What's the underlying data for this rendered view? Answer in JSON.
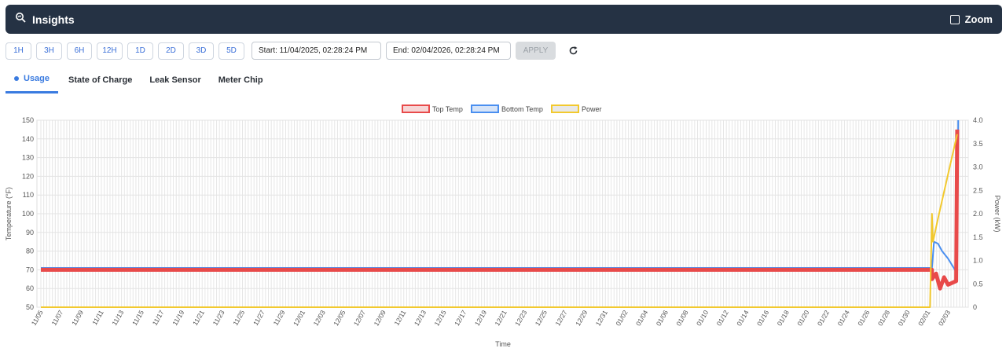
{
  "header": {
    "title": "Insights",
    "zoom_label": "Zoom"
  },
  "toolbar": {
    "ranges": [
      "1H",
      "3H",
      "6H",
      "12H",
      "1D",
      "2D",
      "3D",
      "5D"
    ],
    "start": "Start: 11/04/2025, 02:28:24 PM",
    "end": "End: 02/04/2026, 02:28:24 PM",
    "apply": "APPLY"
  },
  "tabs": [
    {
      "label": "Usage",
      "active": true
    },
    {
      "label": "State of Charge",
      "active": false
    },
    {
      "label": "Leak Sensor",
      "active": false
    },
    {
      "label": "Meter Chip",
      "active": false
    }
  ],
  "colors": {
    "top": "#e84a4a",
    "bottom": "#4a8ff0",
    "power": "#f2c92e",
    "header": "#253244",
    "accent": "#3a7be0"
  },
  "chart_data": {
    "type": "line",
    "xlabel": "Time",
    "ylabel": "Temperature (°F)",
    "y2label": "Power (kW)",
    "ylim": [
      50,
      150
    ],
    "y2lim": [
      0,
      4
    ],
    "yticks": [
      50,
      60,
      70,
      80,
      90,
      100,
      110,
      120,
      130,
      140,
      150
    ],
    "y2ticks": [
      "0",
      "0.5",
      "1.0",
      "1.5",
      "2.0",
      "2.5",
      "3.0",
      "3.5",
      "4.0"
    ],
    "xticks": [
      "11/05",
      "11/07",
      "11/09",
      "11/11",
      "11/13",
      "11/15",
      "11/17",
      "11/19",
      "11/21",
      "11/23",
      "11/25",
      "11/27",
      "11/29",
      "12/01",
      "12/03",
      "12/05",
      "12/07",
      "12/09",
      "12/11",
      "12/13",
      "12/15",
      "12/17",
      "12/19",
      "12/21",
      "12/23",
      "12/25",
      "12/27",
      "12/29",
      "12/31",
      "01/02",
      "01/04",
      "01/06",
      "01/08",
      "01/10",
      "01/12",
      "01/14",
      "01/16",
      "01/18",
      "01/20",
      "01/22",
      "01/24",
      "01/26",
      "01/28",
      "01/30",
      "02/01",
      "02/03"
    ],
    "grid": true,
    "legend_position": "top-center",
    "series": [
      {
        "name": "Top Temp",
        "axis": "left",
        "points": [
          [
            0,
            70
          ],
          [
            44.2,
            70
          ],
          [
            44.2,
            65
          ],
          [
            44.4,
            68
          ],
          [
            44.6,
            60
          ],
          [
            44.8,
            66
          ],
          [
            45.0,
            62
          ],
          [
            45.4,
            64
          ],
          [
            45.45,
            145
          ]
        ]
      },
      {
        "name": "Bottom Temp",
        "axis": "left",
        "points": [
          [
            0,
            71
          ],
          [
            44.2,
            71
          ],
          [
            44.3,
            85
          ],
          [
            44.5,
            84
          ],
          [
            44.7,
            80
          ],
          [
            45.0,
            76
          ],
          [
            45.45,
            68
          ],
          [
            45.5,
            150
          ]
        ]
      },
      {
        "name": "Power",
        "axis": "right",
        "points": [
          [
            0,
            0
          ],
          [
            44.1,
            0
          ],
          [
            44.2,
            2.0
          ],
          [
            44.25,
            1.4
          ],
          [
            44.5,
            1.9
          ],
          [
            45.45,
            3.7
          ]
        ]
      }
    ]
  }
}
